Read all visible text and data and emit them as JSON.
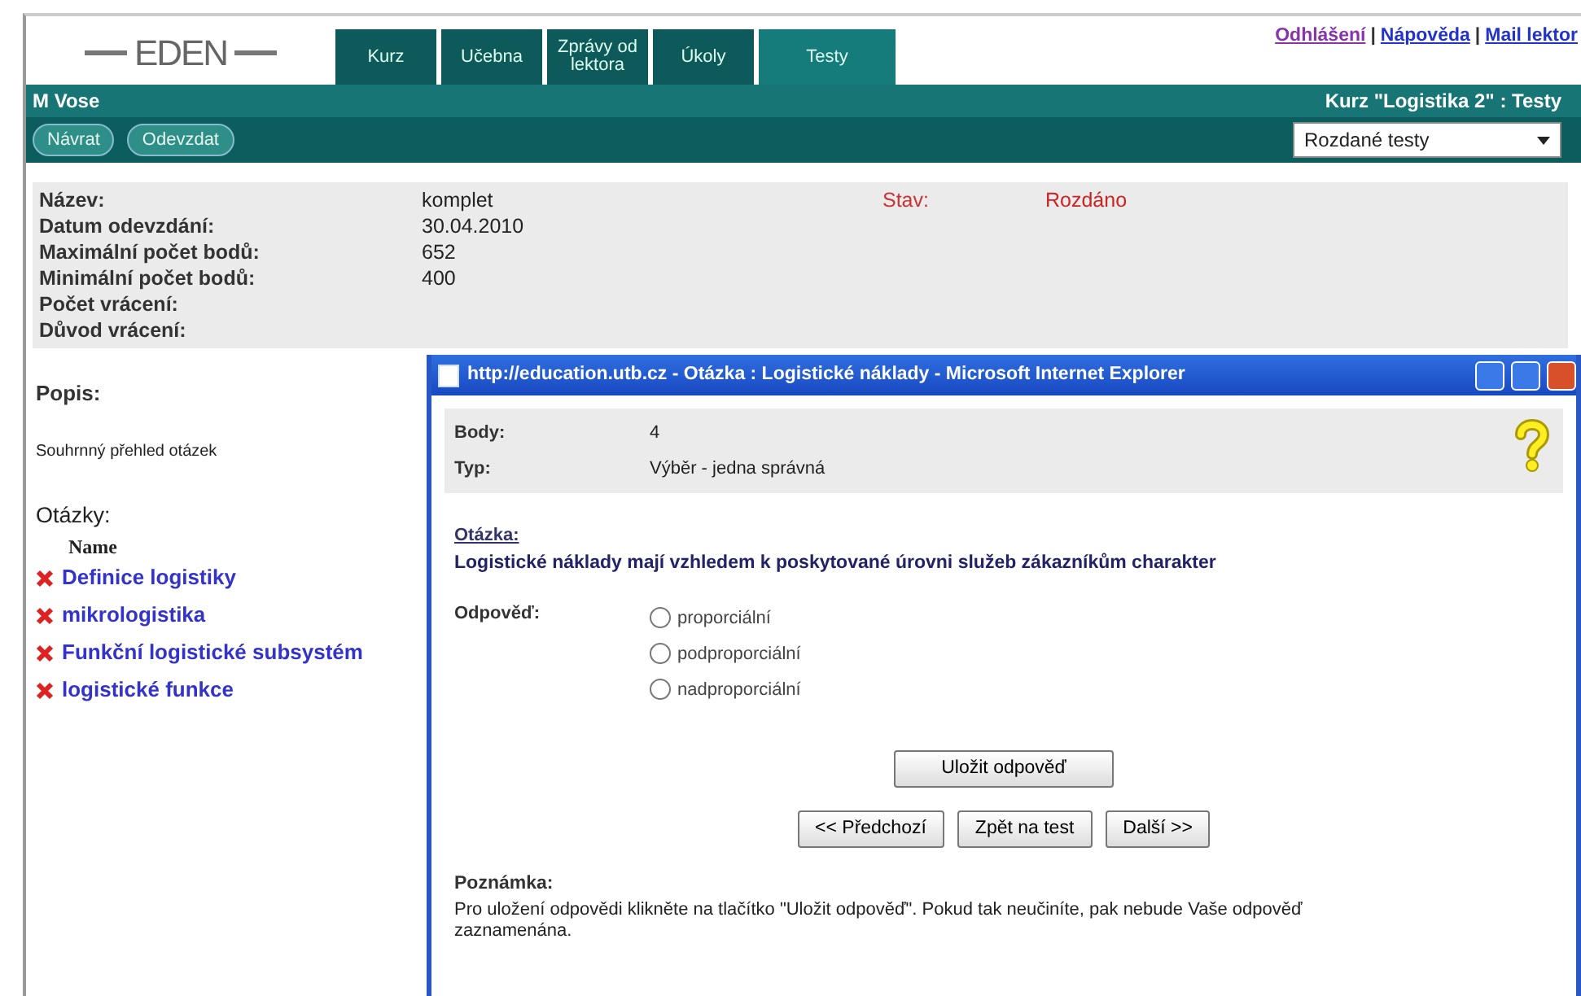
{
  "header": {
    "logo_text": "EDEN",
    "tabs": [
      {
        "label": "Kurz",
        "selected": false
      },
      {
        "label": "Učebna",
        "selected": false
      },
      {
        "label": "Zprávy od lektora",
        "selected": false
      },
      {
        "label": "Úkoly",
        "selected": false
      },
      {
        "label": "Testy",
        "selected": true
      }
    ],
    "links": [
      "Odhlášení",
      "Nápověda",
      "Mail lektor"
    ],
    "link_separator": "|"
  },
  "user_bar": {
    "user": "M Vose",
    "course": "Kurz \"Logistika 2\" : Testy"
  },
  "toolbar": {
    "buttons": [
      "Návrat",
      "Odevzdat"
    ],
    "select": "Rozdané testy"
  },
  "details": [
    {
      "label": "Název:",
      "value": "komplet"
    },
    {
      "label": "Datum odevzdání:",
      "value": "30.04.2010"
    },
    {
      "label": "Maximální počet bodů:",
      "value": "652"
    },
    {
      "label": "Minimální počet bodů:",
      "value": "400"
    },
    {
      "label": "Počet vrácení:"
    },
    {
      "label": "Důvod vrácení:"
    }
  ],
  "status": {
    "label": "Stav:",
    "value": "Rozdáno"
  },
  "description": {
    "label": "Popis:",
    "text": "Souhrnný přehled otázek"
  },
  "questions": {
    "label": "Otázky:",
    "column": "Name",
    "items": [
      "Definice logistiky",
      "mikrologistika",
      "Funkční logistické subsystém",
      "logistické funkce"
    ]
  },
  "popup": {
    "title": "http://education.utb.cz - Otázka : Logistické náklady - Microsoft Internet Explorer",
    "info": [
      {
        "label": "Body:",
        "value": "4"
      },
      {
        "label": "Typ:",
        "value": "Výběr - jedna správná"
      }
    ],
    "question_label": "Otázka:",
    "question": "Logistické náklady mají vzhledem k poskytované úrovni služeb zákazníkům charakter",
    "answer_label": "Odpověď:",
    "options": [
      {
        "label": "proporciální",
        "selected": false
      },
      {
        "label": "podproporciální",
        "selected": false
      },
      {
        "label": "nadproporciální",
        "selected": false
      }
    ],
    "save_button": "Uložit odpověď",
    "nav_buttons": [
      "<< Předchozí",
      "Zpět na test",
      "Další >>"
    ],
    "note_label": "Poznámka:",
    "note": "Pro uložení odpovědi klikněte na tlačítko \"Uložit odpověď\". Pokud tak neučiníte, pak nebude Vaše odpověď zaznamenána."
  }
}
